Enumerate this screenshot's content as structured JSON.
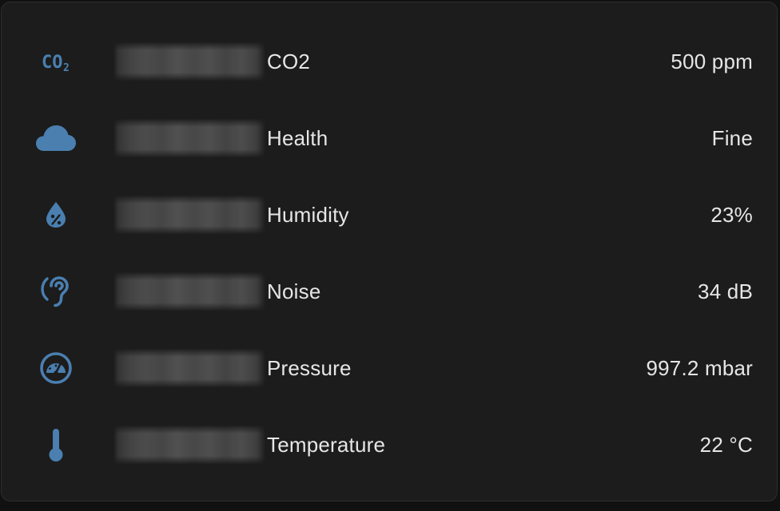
{
  "theme": {
    "icon_color": "#4a7fb0",
    "text_color": "#e6e6e6",
    "card_bg": "#1c1c1c"
  },
  "sensors": [
    {
      "icon": "co2-icon",
      "label": "CO2",
      "value": "500 ppm"
    },
    {
      "icon": "cloud-icon",
      "label": "Health",
      "value": "Fine"
    },
    {
      "icon": "water-percent-icon",
      "label": "Humidity",
      "value": "23%"
    },
    {
      "icon": "ear-icon",
      "label": "Noise",
      "value": "34 dB"
    },
    {
      "icon": "gauge-icon",
      "label": "Pressure",
      "value": "997.2 mbar"
    },
    {
      "icon": "thermometer-icon",
      "label": "Temperature",
      "value": "22 °C"
    }
  ]
}
